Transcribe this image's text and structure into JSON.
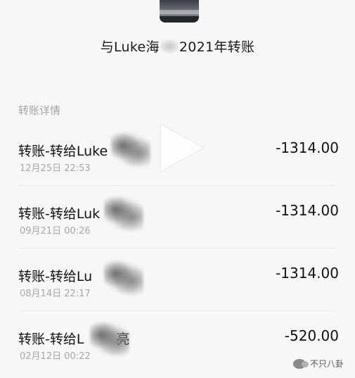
{
  "header": {
    "title_prefix": "与Luke海",
    "title_suffix": "2021年转账"
  },
  "section": {
    "label": "转账详情"
  },
  "transactions": [
    {
      "name": "转账-转给Luke",
      "time": "12月25日 22:53",
      "amount": "-1314.00"
    },
    {
      "name": "转账-转给Luk",
      "time": "09月21日 00:26",
      "amount": "-1314.00"
    },
    {
      "name": "转账-转给Lu",
      "time": "08月14日 22:17",
      "amount": "-1314.00"
    },
    {
      "name": "转账-转给L",
      "name_suffix": "亮",
      "time": "02月12日 00:22",
      "amount": "-520.00"
    }
  ],
  "watermark": {
    "text": "不只八卦",
    "icon": "wechat-icon"
  },
  "overlay": {
    "icon": "play-icon"
  }
}
